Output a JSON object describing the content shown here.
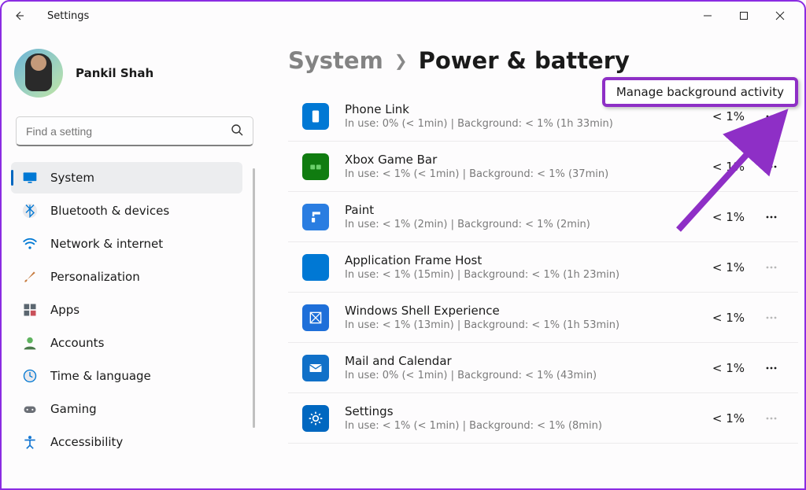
{
  "window": {
    "title": "Settings"
  },
  "profile": {
    "name": "Pankil Shah"
  },
  "search": {
    "placeholder": "Find a setting"
  },
  "breadcrumb": {
    "parent": "System",
    "current": "Power & battery"
  },
  "highlight": {
    "label": "Manage background activity"
  },
  "nav": {
    "items": [
      {
        "id": "system",
        "label": "System",
        "selected": true,
        "icon": "monitor"
      },
      {
        "id": "bluetooth",
        "label": "Bluetooth & devices",
        "icon": "bluetooth"
      },
      {
        "id": "network",
        "label": "Network & internet",
        "icon": "wifi"
      },
      {
        "id": "personalization",
        "label": "Personalization",
        "icon": "brush"
      },
      {
        "id": "apps",
        "label": "Apps",
        "icon": "apps"
      },
      {
        "id": "accounts",
        "label": "Accounts",
        "icon": "person"
      },
      {
        "id": "time",
        "label": "Time & language",
        "icon": "clock"
      },
      {
        "id": "gaming",
        "label": "Gaming",
        "icon": "gamepad"
      },
      {
        "id": "accessibility",
        "label": "Accessibility",
        "icon": "accessibility"
      }
    ]
  },
  "apps": [
    {
      "name": "Phone Link",
      "sub": "In use: 0% (< 1min) | Background: < 1% (1h 33min)",
      "pct": "< 1%",
      "icon": "phone",
      "icon_bg": "#0078d4",
      "more_active": true
    },
    {
      "name": "Xbox Game Bar",
      "sub": "In use: < 1% (< 1min) | Background: < 1% (37min)",
      "pct": "< 1%",
      "icon": "xbox",
      "icon_bg": "#107c10",
      "more_active": true
    },
    {
      "name": "Paint",
      "sub": "In use: < 1% (2min) | Background: < 1% (2min)",
      "pct": "< 1%",
      "icon": "paint",
      "icon_bg": "#2a7de1",
      "more_active": true
    },
    {
      "name": "Application Frame Host",
      "sub": "In use: < 1% (15min) | Background: < 1% (1h 23min)",
      "pct": "< 1%",
      "icon": "square",
      "icon_bg": "#0078d4",
      "more_active": false
    },
    {
      "name": "Windows Shell Experience",
      "sub": "In use: < 1% (13min) | Background: < 1% (1h 53min)",
      "pct": "< 1%",
      "icon": "shell",
      "icon_bg": "#1e6fd9",
      "more_active": false
    },
    {
      "name": "Mail and Calendar",
      "sub": "In use: 0% (< 1min) | Background: < 1% (43min)",
      "pct": "< 1%",
      "icon": "mail",
      "icon_bg": "#1070c8",
      "more_active": true
    },
    {
      "name": "Settings",
      "sub": "In use: < 1% (< 1min) | Background: < 1% (8min)",
      "pct": "< 1%",
      "icon": "gear",
      "icon_bg": "#0067c0",
      "more_active": false
    }
  ]
}
